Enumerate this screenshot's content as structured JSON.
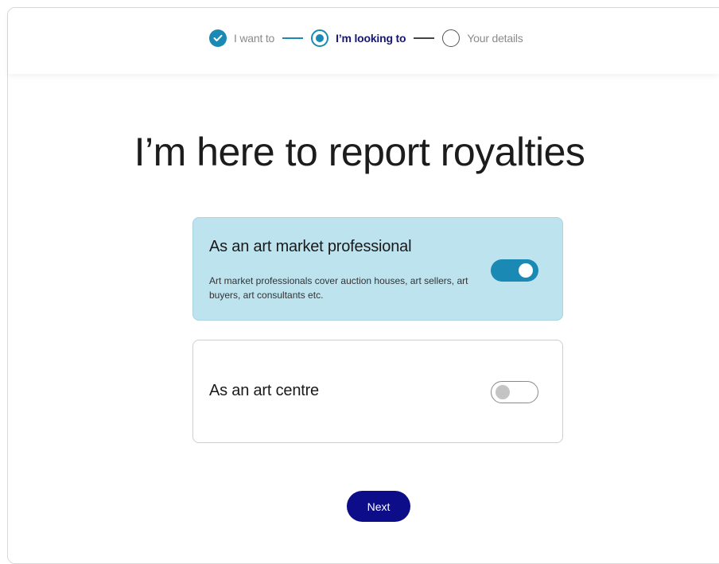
{
  "stepper": {
    "steps": [
      {
        "label": "I want to",
        "state": "done"
      },
      {
        "label": "I’m looking to",
        "state": "current"
      },
      {
        "label": "Your details",
        "state": "todo"
      }
    ]
  },
  "main": {
    "heading": "I’m here to report royalties"
  },
  "options": [
    {
      "title": "As an art market professional",
      "description": "Art market professionals cover auction houses, art sellers, art buyers, art consultants etc.",
      "selected": true
    },
    {
      "title": "As an art centre",
      "description": "",
      "selected": false
    }
  ],
  "actions": {
    "next_label": "Next"
  },
  "colors": {
    "accent": "#1a8ab5",
    "primary": "#0d0d8a",
    "selected_card_bg": "#bde3ef"
  }
}
